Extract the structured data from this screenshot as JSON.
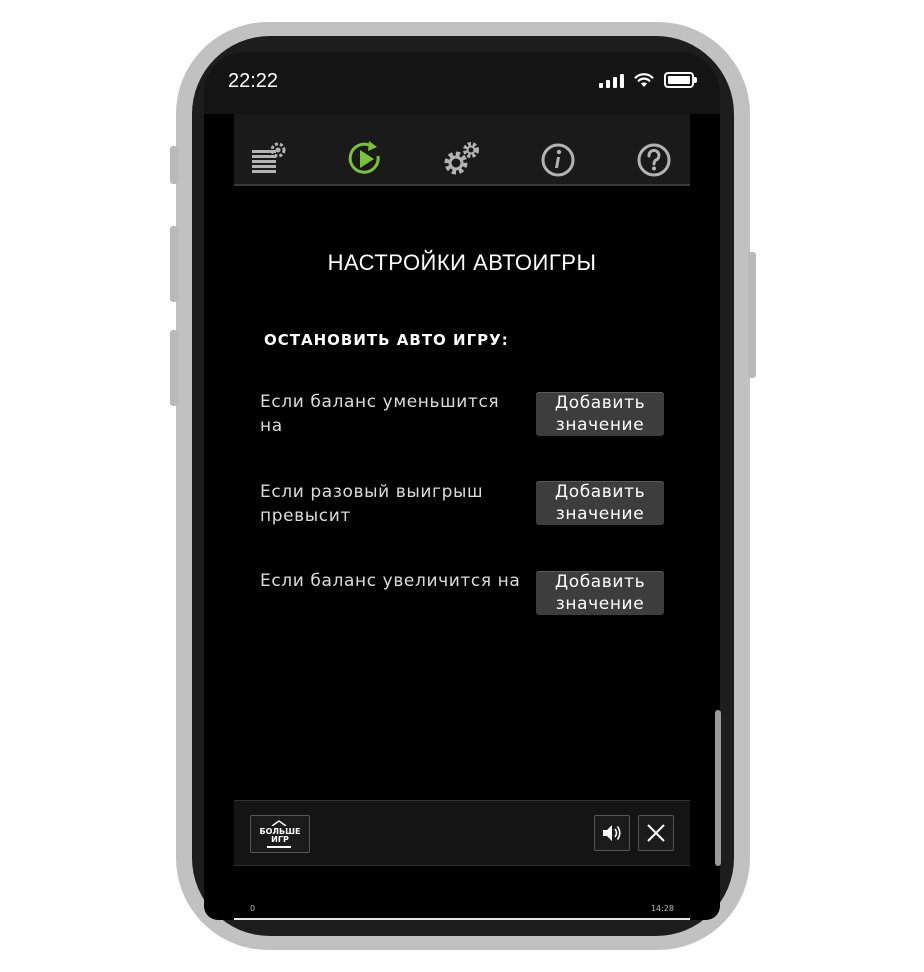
{
  "status_bar": {
    "time": "22:22"
  },
  "toolbar": {
    "items": [
      {
        "icon": "bet-settings-icon",
        "active": false
      },
      {
        "icon": "autoplay-icon",
        "active": true
      },
      {
        "icon": "settings-gears-icon",
        "active": false
      },
      {
        "icon": "info-icon",
        "active": false
      },
      {
        "icon": "help-icon",
        "active": false
      }
    ],
    "accent_color": "#7cc13a",
    "icon_color": "#b3b3b3"
  },
  "panel": {
    "title": "НАСТРОЙКИ АВТОИГРЫ",
    "section_heading": "ОСТАНОВИТЬ АВТО ИГРУ:",
    "rows": [
      {
        "label": "Если баланс уменьшится на",
        "button_line1": "Добавить",
        "button_line2": "значение"
      },
      {
        "label": "Если разовый выигрыш превысит",
        "button_line1": "Добавить",
        "button_line2": "значение"
      },
      {
        "label": "Если баланс увеличится на",
        "button_line1": "Добавить",
        "button_line2": "значение"
      }
    ]
  },
  "bottom_bar": {
    "more_games_line1": "БОЛЬШЕ",
    "more_games_line2": "ИГР",
    "sound_icon": "speaker-icon",
    "close_icon": "close-icon"
  },
  "footer": {
    "left": "0",
    "right": "14:28"
  }
}
